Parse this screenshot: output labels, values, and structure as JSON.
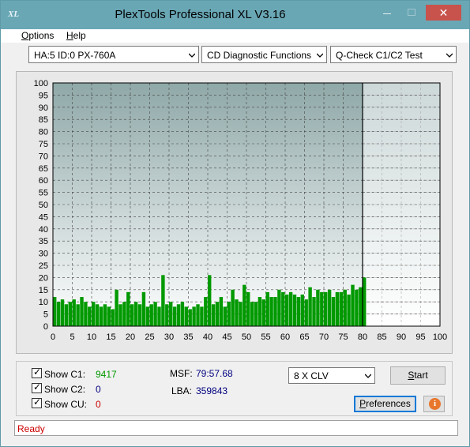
{
  "window": {
    "title": "PlexTools Professional XL V3.16",
    "icon_text": "XL",
    "close_glyph": "✕"
  },
  "menu": [
    {
      "accel": "O",
      "rest": "ptions"
    },
    {
      "accel": "H",
      "rest": "elp"
    }
  ],
  "toolbar": {
    "drive": "HA:5 ID:0  PX-760A",
    "function": "CD Diagnostic Functions",
    "test": "Q-Check C1/C2 Test"
  },
  "stats": {
    "c1_label": "Show C1:",
    "c1_value": "9417",
    "c2_label": "Show C2:",
    "c2_value": "0",
    "cu_label": "Show CU:",
    "cu_value": "0",
    "msf_label": "MSF:",
    "msf_value": "79:57.68",
    "lba_label": "LBA:",
    "lba_value": "359843",
    "checked": true
  },
  "controls": {
    "speed": "8 X CLV",
    "start_accel": "S",
    "start_rest": "tart",
    "prefs_accel": "P",
    "prefs_rest": "references",
    "info_icon": "i"
  },
  "status": {
    "text": "Ready"
  },
  "colors": {
    "titlebar": "#69a7b5",
    "c1_bars": "#009900",
    "c1_value": "#009900",
    "c2_value": "#000080",
    "cu_value": "#cc0000",
    "msf_value": "#000080",
    "lba_value": "#000080",
    "status_text": "#cc0000",
    "chart_bg_top": "#8fa8a8",
    "chart_bg_bottom": "#ffffff"
  },
  "chart_data": {
    "type": "bar",
    "title": "",
    "xlabel": "",
    "ylabel": "",
    "xlim": [
      0,
      100
    ],
    "ylim": [
      0,
      100
    ],
    "xticks": [
      0,
      5,
      10,
      15,
      20,
      25,
      30,
      35,
      40,
      45,
      50,
      55,
      60,
      65,
      70,
      75,
      80,
      85,
      90,
      95,
      100
    ],
    "yticks": [
      0,
      5,
      10,
      15,
      20,
      25,
      30,
      35,
      40,
      45,
      50,
      55,
      60,
      65,
      70,
      75,
      80,
      85,
      90,
      95,
      100
    ],
    "grid": true,
    "disc_end": 80,
    "series": [
      {
        "name": "C1",
        "x": [
          0,
          1,
          2,
          3,
          4,
          5,
          6,
          7,
          8,
          9,
          10,
          11,
          12,
          13,
          14,
          15,
          16,
          17,
          18,
          19,
          20,
          21,
          22,
          23,
          24,
          25,
          26,
          27,
          28,
          29,
          30,
          31,
          32,
          33,
          34,
          35,
          36,
          37,
          38,
          39,
          40,
          41,
          42,
          43,
          44,
          45,
          46,
          47,
          48,
          49,
          50,
          51,
          52,
          53,
          54,
          55,
          56,
          57,
          58,
          59,
          60,
          61,
          62,
          63,
          64,
          65,
          66,
          67,
          68,
          69,
          70,
          71,
          72,
          73,
          74,
          75,
          76,
          77,
          78,
          79,
          80
        ],
        "values": [
          12,
          10,
          11,
          9,
          10,
          11,
          9,
          12,
          10,
          8,
          10,
          9,
          8,
          9,
          8,
          7,
          15,
          9,
          10,
          14,
          9,
          10,
          9,
          14,
          8,
          9,
          10,
          8,
          21,
          9,
          10,
          8,
          9,
          10,
          8,
          7,
          8,
          9,
          8,
          12,
          21,
          9,
          10,
          12,
          8,
          10,
          15,
          11,
          10,
          17,
          14,
          10,
          10,
          12,
          11,
          14,
          12,
          12,
          15,
          14,
          13,
          14,
          13,
          12,
          13,
          11,
          16,
          12,
          15,
          14,
          14,
          15,
          12,
          14,
          14,
          15,
          13,
          17,
          15,
          16,
          20
        ]
      },
      {
        "name": "C2",
        "x": [
          0,
          80
        ],
        "values": [
          0,
          0
        ]
      },
      {
        "name": "CU",
        "x": [
          0,
          80
        ],
        "values": [
          0,
          0
        ]
      }
    ]
  }
}
